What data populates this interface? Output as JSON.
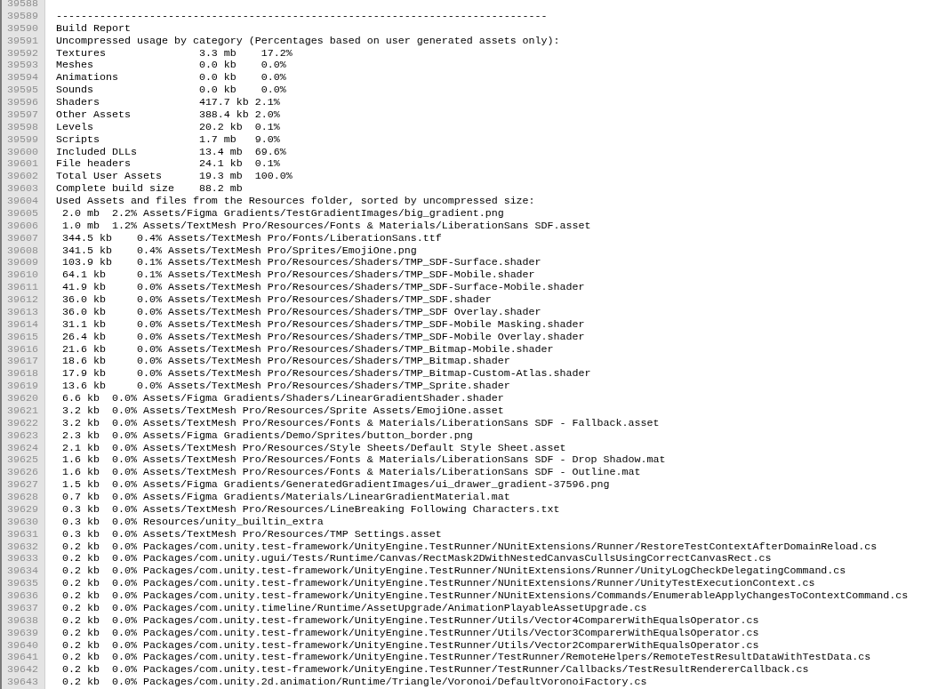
{
  "editor": {
    "lines": [
      {
        "number": "39588"
      },
      {
        "number": "39589",
        "text": "-------------------------------------------------------------------------------"
      },
      {
        "number": "39590",
        "text": "Build Report"
      },
      {
        "number": "39591",
        "text": "Uncompressed usage by category (Percentages based on user generated assets only):"
      },
      {
        "number": "39592",
        "text": "Textures               3.3 mb    17.2%"
      },
      {
        "number": "39593",
        "text": "Meshes                 0.0 kb    0.0%"
      },
      {
        "number": "39594",
        "text": "Animations             0.0 kb    0.0%"
      },
      {
        "number": "39595",
        "text": "Sounds                 0.0 kb    0.0%"
      },
      {
        "number": "39596",
        "text": "Shaders                417.7 kb 2.1%"
      },
      {
        "number": "39597",
        "text": "Other Assets           388.4 kb 2.0%"
      },
      {
        "number": "39598",
        "text": "Levels                 20.2 kb  0.1%"
      },
      {
        "number": "39599",
        "text": "Scripts                1.7 mb   9.0%"
      },
      {
        "number": "39600",
        "text": "Included DLLs          13.4 mb  69.6%"
      },
      {
        "number": "39601",
        "text": "File headers           24.1 kb  0.1%"
      },
      {
        "number": "39602",
        "text": "Total User Assets      19.3 mb  100.0%"
      },
      {
        "number": "39603",
        "text": "Complete build size    88.2 mb"
      },
      {
        "number": "39604",
        "text": "Used Assets and files from the Resources folder, sorted by uncompressed size:"
      },
      {
        "number": "39605",
        "text": " 2.0 mb  2.2% Assets/Figma Gradients/TestGradientImages/big_gradient.png"
      },
      {
        "number": "39606",
        "text": " 1.0 mb  1.2% Assets/TextMesh Pro/Resources/Fonts & Materials/LiberationSans SDF.asset"
      },
      {
        "number": "39607",
        "text": " 344.5 kb    0.4% Assets/TextMesh Pro/Fonts/LiberationSans.ttf"
      },
      {
        "number": "39608",
        "text": " 341.5 kb    0.4% Assets/TextMesh Pro/Sprites/EmojiOne.png"
      },
      {
        "number": "39609",
        "text": " 103.9 kb    0.1% Assets/TextMesh Pro/Resources/Shaders/TMP_SDF-Surface.shader"
      },
      {
        "number": "39610",
        "text": " 64.1 kb     0.1% Assets/TextMesh Pro/Resources/Shaders/TMP_SDF-Mobile.shader"
      },
      {
        "number": "39611",
        "text": " 41.9 kb     0.0% Assets/TextMesh Pro/Resources/Shaders/TMP_SDF-Surface-Mobile.shader"
      },
      {
        "number": "39612",
        "text": " 36.0 kb     0.0% Assets/TextMesh Pro/Resources/Shaders/TMP_SDF.shader"
      },
      {
        "number": "39613",
        "text": " 36.0 kb     0.0% Assets/TextMesh Pro/Resources/Shaders/TMP_SDF Overlay.shader"
      },
      {
        "number": "39614",
        "text": " 31.1 kb     0.0% Assets/TextMesh Pro/Resources/Shaders/TMP_SDF-Mobile Masking.shader"
      },
      {
        "number": "39615",
        "text": " 26.4 kb     0.0% Assets/TextMesh Pro/Resources/Shaders/TMP_SDF-Mobile Overlay.shader"
      },
      {
        "number": "39616",
        "text": " 21.6 kb     0.0% Assets/TextMesh Pro/Resources/Shaders/TMP_Bitmap-Mobile.shader"
      },
      {
        "number": "39617",
        "text": " 18.6 kb     0.0% Assets/TextMesh Pro/Resources/Shaders/TMP_Bitmap.shader"
      },
      {
        "number": "39618",
        "text": " 17.9 kb     0.0% Assets/TextMesh Pro/Resources/Shaders/TMP_Bitmap-Custom-Atlas.shader"
      },
      {
        "number": "39619",
        "text": " 13.6 kb     0.0% Assets/TextMesh Pro/Resources/Shaders/TMP_Sprite.shader"
      },
      {
        "number": "39620",
        "text": " 6.6 kb  0.0% Assets/Figma Gradients/Shaders/LinearGradientShader.shader"
      },
      {
        "number": "39621",
        "text": " 3.2 kb  0.0% Assets/TextMesh Pro/Resources/Sprite Assets/EmojiOne.asset"
      },
      {
        "number": "39622",
        "text": " 3.2 kb  0.0% Assets/TextMesh Pro/Resources/Fonts & Materials/LiberationSans SDF - Fallback.asset"
      },
      {
        "number": "39623",
        "text": " 2.3 kb  0.0% Assets/Figma Gradients/Demo/Sprites/button_border.png"
      },
      {
        "number": "39624",
        "text": " 2.1 kb  0.0% Assets/TextMesh Pro/Resources/Style Sheets/Default Style Sheet.asset"
      },
      {
        "number": "39625",
        "text": " 1.6 kb  0.0% Assets/TextMesh Pro/Resources/Fonts & Materials/LiberationSans SDF - Drop Shadow.mat"
      },
      {
        "number": "39626",
        "text": " 1.6 kb  0.0% Assets/TextMesh Pro/Resources/Fonts & Materials/LiberationSans SDF - Outline.mat"
      },
      {
        "number": "39627",
        "text": " 1.5 kb  0.0% Assets/Figma Gradients/GeneratedGradientImages/ui_drawer_gradient-37596.png"
      },
      {
        "number": "39628",
        "text": " 0.7 kb  0.0% Assets/Figma Gradients/Materials/LinearGradientMaterial.mat"
      },
      {
        "number": "39629",
        "text": " 0.3 kb  0.0% Assets/TextMesh Pro/Resources/LineBreaking Following Characters.txt"
      },
      {
        "number": "39630",
        "text": " 0.3 kb  0.0% Resources/unity_builtin_extra"
      },
      {
        "number": "39631",
        "text": " 0.3 kb  0.0% Assets/TextMesh Pro/Resources/TMP Settings.asset"
      },
      {
        "number": "39632",
        "text": " 0.2 kb  0.0% Packages/com.unity.test-framework/UnityEngine.TestRunner/NUnitExtensions/Runner/RestoreTestContextAfterDomainReload.cs"
      },
      {
        "number": "39633",
        "text": " 0.2 kb  0.0% Packages/com.unity.ugui/Tests/Runtime/Canvas/RectMask2DWithNestedCanvasCullsUsingCorrectCanvasRect.cs"
      },
      {
        "number": "39634",
        "text": " 0.2 kb  0.0% Packages/com.unity.test-framework/UnityEngine.TestRunner/NUnitExtensions/Runner/UnityLogCheckDelegatingCommand.cs"
      },
      {
        "number": "39635",
        "text": " 0.2 kb  0.0% Packages/com.unity.test-framework/UnityEngine.TestRunner/NUnitExtensions/Runner/UnityTestExecutionContext.cs"
      },
      {
        "number": "39636",
        "text": " 0.2 kb  0.0% Packages/com.unity.test-framework/UnityEngine.TestRunner/NUnitExtensions/Commands/EnumerableApplyChangesToContextCommand.cs"
      },
      {
        "number": "39637",
        "text": " 0.2 kb  0.0% Packages/com.unity.timeline/Runtime/AssetUpgrade/AnimationPlayableAssetUpgrade.cs"
      },
      {
        "number": "39638",
        "text": " 0.2 kb  0.0% Packages/com.unity.test-framework/UnityEngine.TestRunner/Utils/Vector4ComparerWithEqualsOperator.cs"
      },
      {
        "number": "39639",
        "text": " 0.2 kb  0.0% Packages/com.unity.test-framework/UnityEngine.TestRunner/Utils/Vector3ComparerWithEqualsOperator.cs"
      },
      {
        "number": "39640",
        "text": " 0.2 kb  0.0% Packages/com.unity.test-framework/UnityEngine.TestRunner/Utils/Vector2ComparerWithEqualsOperator.cs"
      },
      {
        "number": "39641",
        "text": " 0.2 kb  0.0% Packages/com.unity.test-framework/UnityEngine.TestRunner/TestRunner/RemoteHelpers/RemoteTestResultDataWithTestData.cs"
      },
      {
        "number": "39642",
        "text": " 0.2 kb  0.0% Packages/com.unity.test-framework/UnityEngine.TestRunner/TestRunner/Callbacks/TestResultRendererCallback.cs"
      },
      {
        "number": "39643",
        "text": " 0.2 kb  0.0% Packages/com.unity.2d.animation/Runtime/Triangle/Voronoi/DefaultVoronoiFactory.cs"
      }
    ]
  }
}
